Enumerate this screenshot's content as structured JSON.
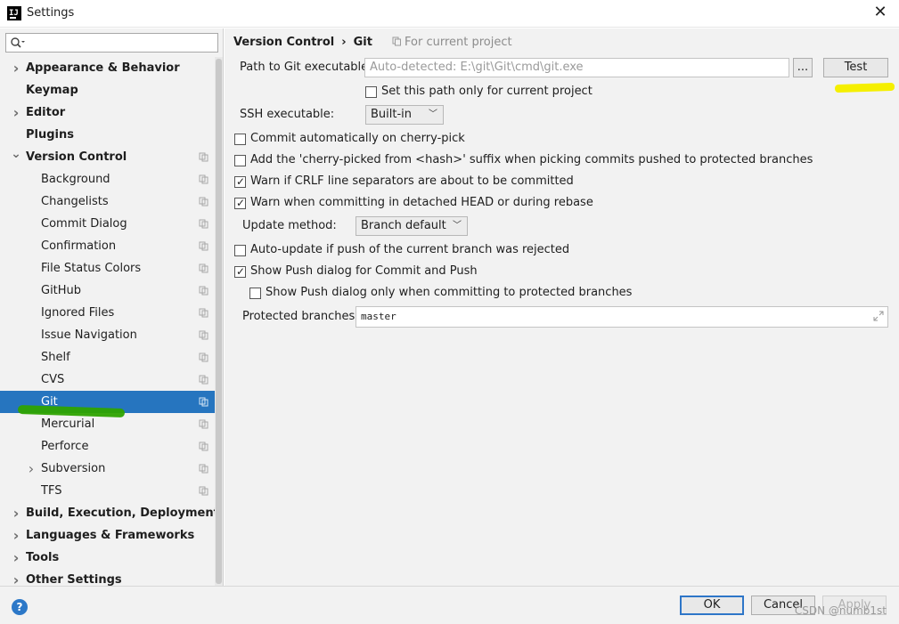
{
  "window": {
    "title": "Settings",
    "close_icon": "close-icon",
    "app_icon": "intellij-idea-icon"
  },
  "search": {
    "placeholder": "",
    "value": "",
    "icon": "search-icon"
  },
  "sidebar": {
    "items": [
      {
        "label": "Appearance & Behavior",
        "level": 0,
        "bold": true,
        "expand": "collapsed",
        "copy_icon": false
      },
      {
        "label": "Keymap",
        "level": 0,
        "bold": true,
        "expand": "none",
        "copy_icon": false
      },
      {
        "label": "Editor",
        "level": 0,
        "bold": true,
        "expand": "collapsed",
        "copy_icon": false
      },
      {
        "label": "Plugins",
        "level": 0,
        "bold": true,
        "expand": "none",
        "copy_icon": false
      },
      {
        "label": "Version Control",
        "level": 0,
        "bold": true,
        "expand": "expanded",
        "copy_icon": true
      },
      {
        "label": "Background",
        "level": 1,
        "bold": false,
        "expand": "none",
        "copy_icon": true
      },
      {
        "label": "Changelists",
        "level": 1,
        "bold": false,
        "expand": "none",
        "copy_icon": true
      },
      {
        "label": "Commit Dialog",
        "level": 1,
        "bold": false,
        "expand": "none",
        "copy_icon": true
      },
      {
        "label": "Confirmation",
        "level": 1,
        "bold": false,
        "expand": "none",
        "copy_icon": true
      },
      {
        "label": "File Status Colors",
        "level": 1,
        "bold": false,
        "expand": "none",
        "copy_icon": true
      },
      {
        "label": "GitHub",
        "level": 1,
        "bold": false,
        "expand": "none",
        "copy_icon": true
      },
      {
        "label": "Ignored Files",
        "level": 1,
        "bold": false,
        "expand": "none",
        "copy_icon": true
      },
      {
        "label": "Issue Navigation",
        "level": 1,
        "bold": false,
        "expand": "none",
        "copy_icon": true
      },
      {
        "label": "Shelf",
        "level": 1,
        "bold": false,
        "expand": "none",
        "copy_icon": true
      },
      {
        "label": "CVS",
        "level": 1,
        "bold": false,
        "expand": "none",
        "copy_icon": true
      },
      {
        "label": "Git",
        "level": 1,
        "bold": false,
        "expand": "none",
        "copy_icon": true,
        "selected": true
      },
      {
        "label": "Mercurial",
        "level": 1,
        "bold": false,
        "expand": "none",
        "copy_icon": true
      },
      {
        "label": "Perforce",
        "level": 1,
        "bold": false,
        "expand": "none",
        "copy_icon": true
      },
      {
        "label": "Subversion",
        "level": 1,
        "bold": false,
        "expand": "collapsed",
        "copy_icon": true
      },
      {
        "label": "TFS",
        "level": 1,
        "bold": false,
        "expand": "none",
        "copy_icon": true
      },
      {
        "label": "Build, Execution, Deployment",
        "level": 0,
        "bold": true,
        "expand": "collapsed",
        "copy_icon": false
      },
      {
        "label": "Languages & Frameworks",
        "level": 0,
        "bold": true,
        "expand": "collapsed",
        "copy_icon": false
      },
      {
        "label": "Tools",
        "level": 0,
        "bold": true,
        "expand": "collapsed",
        "copy_icon": false
      },
      {
        "label": "Other Settings",
        "level": 0,
        "bold": true,
        "expand": "collapsed",
        "copy_icon": false
      }
    ]
  },
  "main": {
    "breadcrumb": {
      "parent": "Version Control",
      "separator": "›",
      "current": "Git"
    },
    "for_project": "For current project",
    "git_path": {
      "label": "Path to Git executable:",
      "placeholder": "Auto-detected: E:\\git\\Git\\cmd\\git.exe",
      "browse_label": "...",
      "test_label": "Test"
    },
    "set_path_current": {
      "label": "Set this path only for current project",
      "checked": false
    },
    "ssh": {
      "label": "SSH executable:",
      "value": "Built-in"
    },
    "options": [
      {
        "label": "Commit automatically on cherry-pick",
        "checked": false
      },
      {
        "label": "Add the 'cherry-picked from <hash>' suffix when picking commits pushed to protected branches",
        "checked": false
      },
      {
        "label": "Warn if CRLF line separators are about to be committed",
        "checked": true
      },
      {
        "label": "Warn when committing in detached HEAD or during rebase",
        "checked": true
      }
    ],
    "update_method": {
      "label": "Update method:",
      "value": "Branch default"
    },
    "auto_update": {
      "label": "Auto-update if push of the current branch was rejected",
      "checked": false
    },
    "show_push": {
      "label": "Show Push dialog for Commit and Push",
      "checked": true
    },
    "show_push_protected": {
      "label": "Show Push dialog only when committing to protected branches",
      "checked": false
    },
    "protected_branches": {
      "label": "Protected branches:",
      "value": "master"
    }
  },
  "footer": {
    "help_label": "?",
    "ok_label": "OK",
    "cancel_label": "Cancel",
    "apply_label": "Apply",
    "watermark": "CSDN @numb1st"
  },
  "colors": {
    "selection": "#2675bf",
    "accent": "#2e76c8",
    "highlight_green": "#2ea300",
    "highlight_yellow": "#f5ef00"
  }
}
